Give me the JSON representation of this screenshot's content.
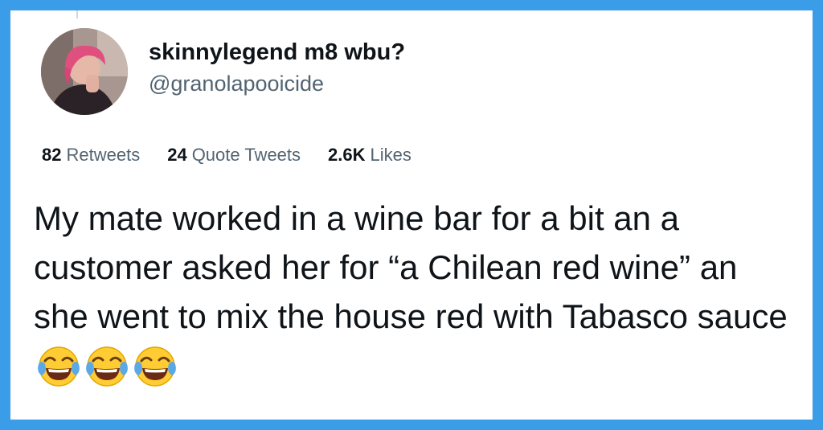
{
  "tweet": {
    "display_name": "skinnylegend m8 wbu?",
    "handle": "@granolapooicide",
    "stats": [
      {
        "count": "82",
        "label": "Retweets"
      },
      {
        "count": "24",
        "label": "Quote Tweets"
      },
      {
        "count": "2.6K",
        "label": "Likes"
      }
    ],
    "text": "My mate worked in a wine bar for a bit an a customer asked her for “a Chilean red wine” an she went to mix the house red with Tabasco sauce",
    "emojis": [
      "face-with-tears-of-joy-icon",
      "face-with-tears-of-joy-icon",
      "face-with-tears-of-joy-icon"
    ]
  },
  "colors": {
    "frame_border": "#3b9ce8",
    "text_primary": "#0f1419",
    "text_secondary": "#536471"
  }
}
